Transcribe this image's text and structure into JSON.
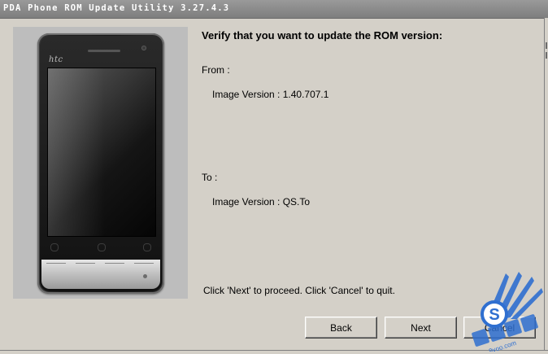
{
  "window": {
    "title": "PDA Phone ROM Update Utility 3.27.4.3"
  },
  "device_image": {
    "brand": "htc"
  },
  "content": {
    "heading": "Verify that you want to update the ROM version:",
    "from_label": "From :",
    "from_version": "Image Version : 1.40.707.1",
    "to_label": "To :",
    "to_version": "Image Version : QS.To",
    "instruction": "Click 'Next' to proceed. Click 'Cancel' to quit."
  },
  "buttons": {
    "back": "Back",
    "next": "Next",
    "cancel": "Cancel"
  },
  "watermark": {
    "text": "9yoo.com"
  },
  "colors": {
    "window_bg": "#d4d0c8",
    "titlebar": "#8a8a8a",
    "watermark_blue": "#2f6fd0"
  }
}
